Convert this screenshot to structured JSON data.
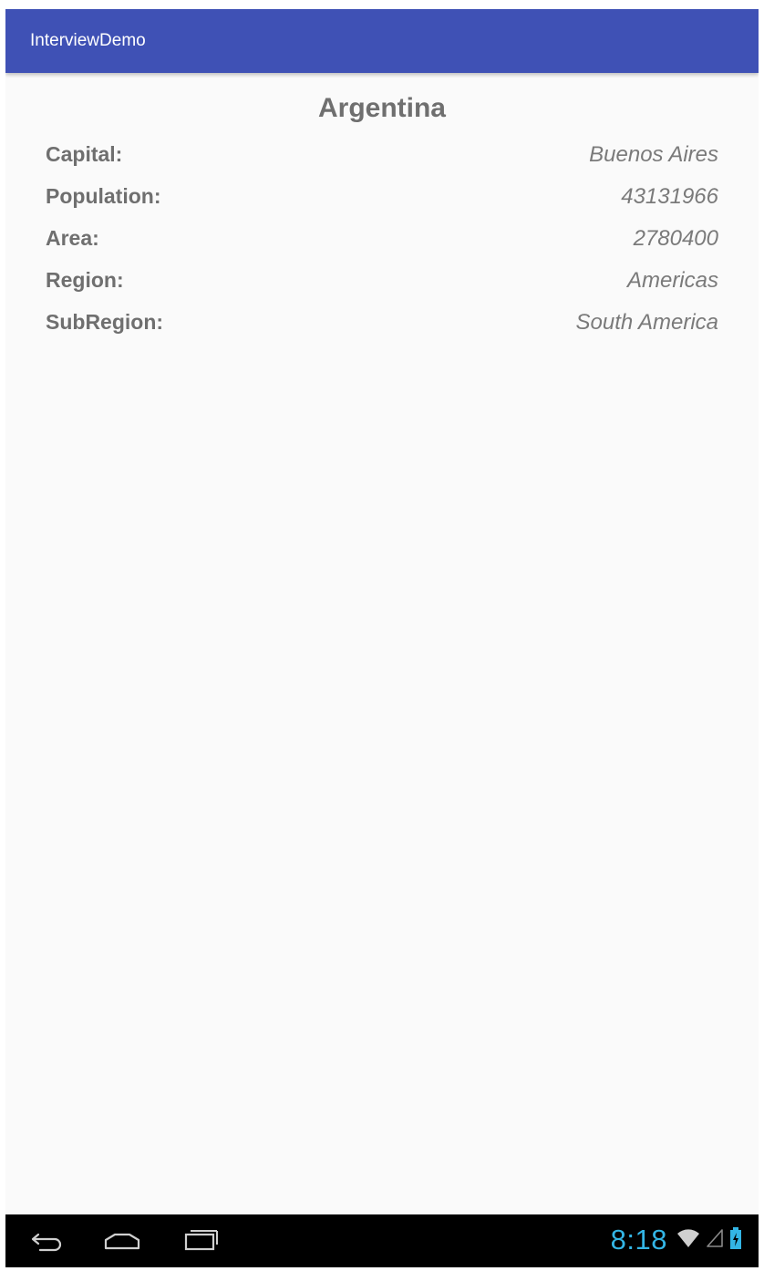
{
  "app_bar": {
    "title": "InterviewDemo",
    "color": "#3f51b5"
  },
  "country": {
    "name": "Argentina",
    "details": [
      {
        "label": "Capital:",
        "value": "Buenos Aires"
      },
      {
        "label": "Population:",
        "value": "43131966"
      },
      {
        "label": "Area:",
        "value": "2780400"
      },
      {
        "label": "Region:",
        "value": "Americas"
      },
      {
        "label": "SubRegion:",
        "value": "South America"
      }
    ]
  },
  "nav_bar": {
    "buttons": [
      "back-icon",
      "home-icon",
      "recent-apps-icon"
    ]
  },
  "status": {
    "time": "8:18",
    "icons": [
      "wifi-icon",
      "cell-signal-icon",
      "battery-charging-icon"
    ],
    "accent": "#33b5e5"
  }
}
